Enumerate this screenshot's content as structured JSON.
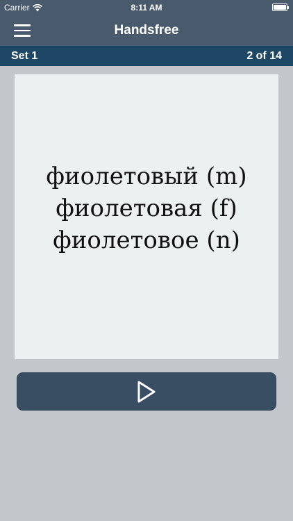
{
  "status_bar": {
    "carrier": "Carrier",
    "time": "8:11 AM",
    "battery_level": 1.0
  },
  "nav": {
    "title": "Handsfree",
    "menu_icon": "hamburger-menu-icon"
  },
  "sub_bar": {
    "set_label": "Set 1",
    "progress": "2 of 14"
  },
  "card": {
    "lines": [
      "фиолетовый (m)",
      "фиолетовая (f)",
      "фиолетовое (n)"
    ]
  },
  "play_button": {
    "icon": "play-icon"
  },
  "colors": {
    "nav_background": "#485a6c",
    "sub_bar_background": "#1e4766",
    "page_background": "#c2c7cb",
    "card_background": "#ecf0f1",
    "button_background": "#3a4e63"
  }
}
